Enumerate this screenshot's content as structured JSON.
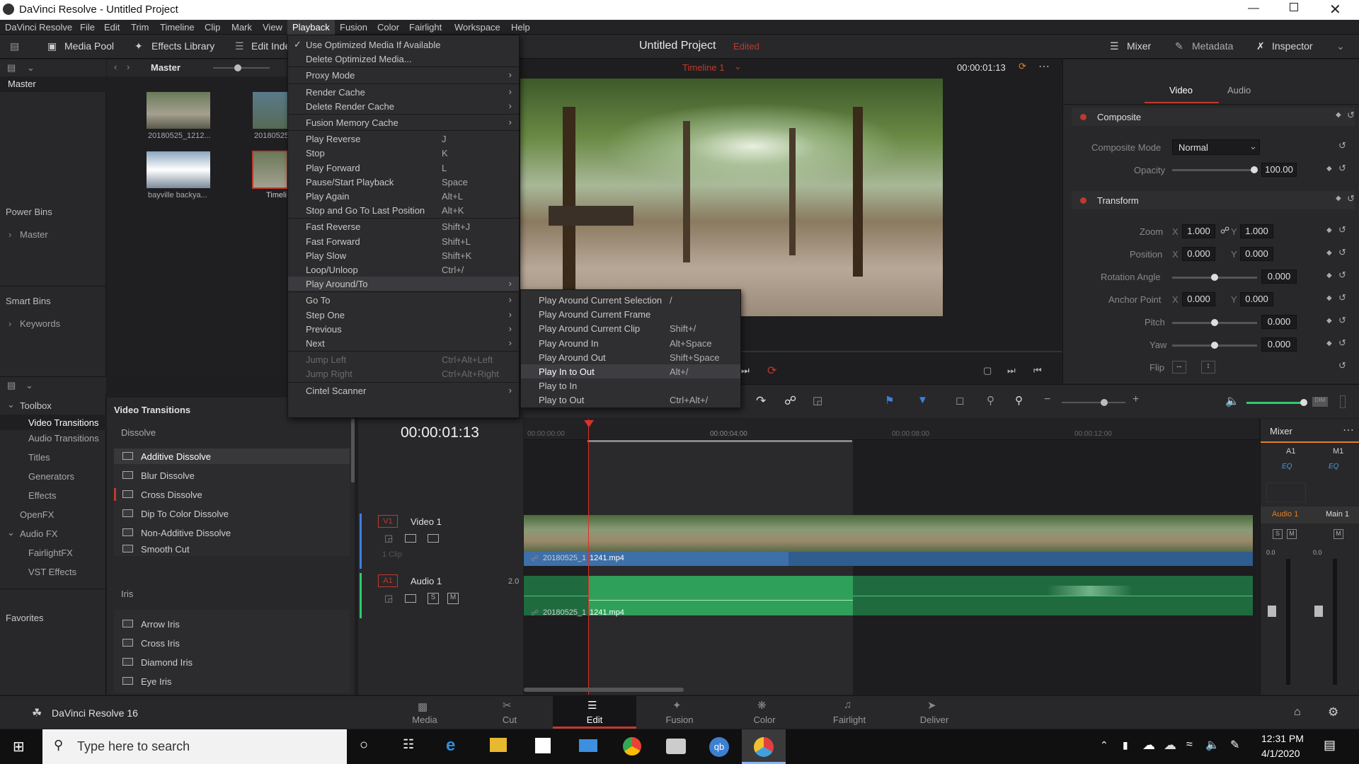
{
  "window": {
    "title": "DaVinci Resolve - Untitled Project"
  },
  "menubar": [
    "DaVinci Resolve",
    "File",
    "Edit",
    "Trim",
    "Timeline",
    "Clip",
    "Mark",
    "View",
    "Playback",
    "Fusion",
    "Color",
    "Fairlight",
    "Workspace",
    "Help"
  ],
  "toolbar": {
    "media_pool": "Media Pool",
    "effects_library": "Effects Library",
    "edit_index": "Edit Inde",
    "project_title": "Untitled Project",
    "edited": "Edited",
    "mixer": "Mixer",
    "metadata": "Metadata",
    "inspector": "Inspector"
  },
  "media_pool": {
    "bin_label": "Master",
    "tree_master": "Master",
    "power_bins": "Power Bins",
    "power_master": "Master",
    "smart_bins": "Smart Bins",
    "keywords": "Keywords",
    "clips": [
      {
        "name": "20180525_1212..."
      },
      {
        "name": "20180525"
      },
      {
        "name": "bayville backya..."
      },
      {
        "name": "Timeli"
      }
    ]
  },
  "effects": {
    "toolbox": "Toolbox",
    "video_transitions": "Video Transitions",
    "audio_transitions": "Audio Transitions",
    "titles": "Titles",
    "generators": "Generators",
    "effects": "Effects",
    "openfx": "OpenFX",
    "audio_fx": "Audio FX",
    "fairlightfx": "FairlightFX",
    "vst": "VST Effects",
    "favorites": "Favorites",
    "panel_title": "Video Transitions",
    "dissolve_header": "Dissolve",
    "dissolve": [
      "Additive Dissolve",
      "Blur Dissolve",
      "Cross Dissolve",
      "Dip To Color Dissolve",
      "Non-Additive Dissolve",
      "Smooth Cut"
    ],
    "iris_header": "Iris",
    "iris": [
      "Arrow Iris",
      "Cross Iris",
      "Diamond Iris",
      "Eye Iris"
    ]
  },
  "playback_menu": [
    {
      "label": "Use Optimized Media If Available",
      "check": true
    },
    {
      "label": "Delete Optimized Media..."
    },
    {
      "sep": true
    },
    {
      "label": "Proxy Mode",
      "sub": true
    },
    {
      "sep": true
    },
    {
      "label": "Render Cache",
      "sub": true
    },
    {
      "label": "Delete Render Cache",
      "sub": true
    },
    {
      "sep": true
    },
    {
      "label": "Fusion Memory Cache",
      "sub": true
    },
    {
      "sep": true
    },
    {
      "label": "Play Reverse",
      "key": "J"
    },
    {
      "label": "Stop",
      "key": "K"
    },
    {
      "label": "Play Forward",
      "key": "L"
    },
    {
      "label": "Pause/Start Playback",
      "key": "Space"
    },
    {
      "label": "Play Again",
      "key": "Alt+L"
    },
    {
      "label": "Stop and Go To Last Position",
      "key": "Alt+K"
    },
    {
      "sep": true
    },
    {
      "label": "Fast Reverse",
      "key": "Shift+J"
    },
    {
      "label": "Fast Forward",
      "key": "Shift+L"
    },
    {
      "label": "Play Slow",
      "key": "Shift+K"
    },
    {
      "label": "Loop/Unloop",
      "key": "Ctrl+/"
    },
    {
      "label": "Play Around/To",
      "sub": true,
      "hl": true
    },
    {
      "sep": true
    },
    {
      "label": "Go To",
      "sub": true
    },
    {
      "label": "Step One",
      "sub": true
    },
    {
      "label": "Previous",
      "sub": true
    },
    {
      "label": "Next",
      "sub": true
    },
    {
      "sep": true
    },
    {
      "label": "Jump Left",
      "key": "Ctrl+Alt+Left",
      "dis": true
    },
    {
      "label": "Jump Right",
      "key": "Ctrl+Alt+Right",
      "dis": true
    },
    {
      "sep": true
    },
    {
      "label": "Cintel Scanner",
      "sub": true
    }
  ],
  "submenu": [
    {
      "label": "Play Around Current Selection",
      "key": "/"
    },
    {
      "label": "Play Around Current Frame",
      "key": ""
    },
    {
      "label": "Play Around Current Clip",
      "key": "Shift+/"
    },
    {
      "label": "Play Around In",
      "key": "Alt+Space"
    },
    {
      "label": "Play Around Out",
      "key": "Shift+Space"
    },
    {
      "label": "Play In to Out",
      "key": "Alt+/",
      "hl": true
    },
    {
      "label": "Play to In",
      "key": ""
    },
    {
      "label": "Play to Out",
      "key": "Ctrl+Alt+/"
    }
  ],
  "viewer": {
    "timeline_name": "Timeline 1",
    "timecode": "00:00:01:13"
  },
  "inspector": {
    "tab_video": "Video",
    "tab_audio": "Audio",
    "composite": "Composite",
    "composite_mode_label": "Composite Mode",
    "composite_mode": "Normal",
    "opacity_label": "Opacity",
    "opacity": "100.00",
    "transform": "Transform",
    "zoom_label": "Zoom",
    "zoom_x": "1.000",
    "zoom_y": "1.000",
    "position_label": "Position",
    "pos_x": "0.000",
    "pos_y": "0.000",
    "rotation_label": "Rotation Angle",
    "rotation": "0.000",
    "anchor_label": "Anchor Point",
    "anchor_x": "0.000",
    "anchor_y": "0.000",
    "pitch_label": "Pitch",
    "pitch": "0.000",
    "yaw_label": "Yaw",
    "yaw": "0.000",
    "flip_label": "Flip",
    "x": "X",
    "y": "Y"
  },
  "timeline": {
    "timecode": "00:00:01:13",
    "ruler": [
      "00:00:00:00",
      "00:00:04:00",
      "00:00:08:00",
      "00:00:12:00"
    ],
    "v1": "V1",
    "video_track": "Video 1",
    "clip_count": "1 Clip",
    "a1": "A1",
    "audio_track": "Audio 1",
    "audio_level": "2.0",
    "clip_name": "20180525_1_1241.mp4",
    "clip_name_a": "1241.mp4",
    "clip_prefix": "20180525_1"
  },
  "mixer": {
    "title": "Mixer",
    "a1": "A1",
    "m1": "M1",
    "eq": "EQ",
    "audio1": "Audio 1",
    "main1": "Main 1",
    "s": "S",
    "m": "M",
    "db": "0.0"
  },
  "app_footer": {
    "name": "DaVinci Resolve 16"
  },
  "pages": [
    "Media",
    "Cut",
    "Edit",
    "Fusion",
    "Color",
    "Fairlight",
    "Deliver"
  ],
  "taskbar": {
    "search_placeholder": "Type here to search",
    "time": "12:31 PM",
    "date": "4/1/2020"
  }
}
